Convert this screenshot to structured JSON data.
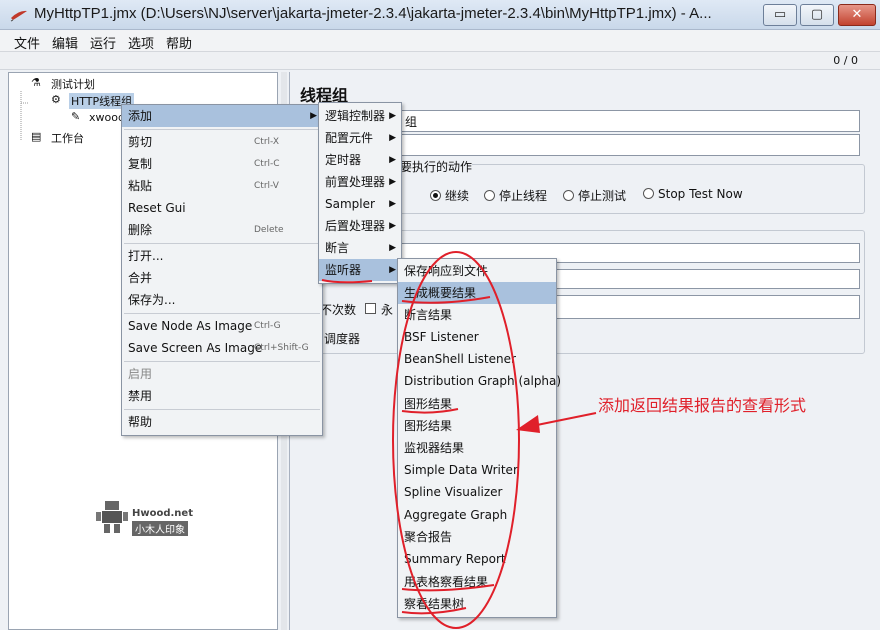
{
  "window": {
    "title": "MyHttpTP1.jmx (D:\\Users\\NJ\\server\\jakarta-jmeter-2.3.4\\jakarta-jmeter-2.3.4\\bin\\MyHttpTP1.jmx) - A...",
    "minimize_label": "▭",
    "maximize_label": "▢",
    "close_label": "✕"
  },
  "menubar": {
    "items": [
      "文件",
      "编辑",
      "运行",
      "选项",
      "帮助"
    ]
  },
  "toolbar": {
    "counter": "0 / 0"
  },
  "tree": {
    "nodes": [
      "测试计划",
      "HTTP线程组",
      "xwood",
      "工作台"
    ]
  },
  "panel": {
    "title": "线程组",
    "name_field_value": "组",
    "comment_field_value": "",
    "error_action_label": "要执行的动作",
    "radios": [
      "继续",
      "停止线程",
      "停止测试",
      "Stop Test Now"
    ],
    "loop_label": "不次数",
    "forever_label": "永",
    "scheduler_label": "调度器"
  },
  "context_menu": {
    "items": [
      {
        "label": "添加",
        "shortcut": ""
      },
      {
        "label": "剪切",
        "shortcut": "Ctrl-X"
      },
      {
        "label": "复制",
        "shortcut": "Ctrl-C"
      },
      {
        "label": "粘贴",
        "shortcut": "Ctrl-V"
      },
      {
        "label": "Reset Gui",
        "shortcut": ""
      },
      {
        "label": "删除",
        "shortcut": "Delete"
      },
      {
        "label": "打开...",
        "shortcut": ""
      },
      {
        "label": "合并",
        "shortcut": ""
      },
      {
        "label": "保存为...",
        "shortcut": ""
      },
      {
        "label": "Save Node As Image",
        "shortcut": "Ctrl-G"
      },
      {
        "label": "Save Screen As Image",
        "shortcut": "Ctrl+Shift-G"
      },
      {
        "label": "启用",
        "shortcut": ""
      },
      {
        "label": "禁用",
        "shortcut": ""
      },
      {
        "label": "帮助",
        "shortcut": ""
      }
    ]
  },
  "add_submenu": {
    "items": [
      "逻辑控制器",
      "配置元件",
      "定时器",
      "前置处理器",
      "Sampler",
      "后置处理器",
      "断言",
      "监听器"
    ]
  },
  "listener_submenu": {
    "items": [
      "保存响应到文件",
      "生成概要结果",
      "断言结果",
      "BSF Listener",
      "BeanShell Listener",
      "Distribution Graph (alpha)",
      "图形结果",
      "图形结果",
      "监视器结果",
      "Simple Data Writer",
      "Spline Visualizer",
      "Aggregate Graph",
      "聚合报告",
      "Summary Report",
      "用表格察看结果",
      "察看结果树"
    ]
  },
  "annotation": {
    "text": "添加返回结果报告的查看形式",
    "color": "#e0202a"
  },
  "watermark": {
    "title": "Hwood.net",
    "subtitle": "小木人印象"
  },
  "colors": {
    "highlight": "#a9c1dd",
    "tree_selection": "#b9cfe7",
    "annotation": "#e0202a"
  }
}
